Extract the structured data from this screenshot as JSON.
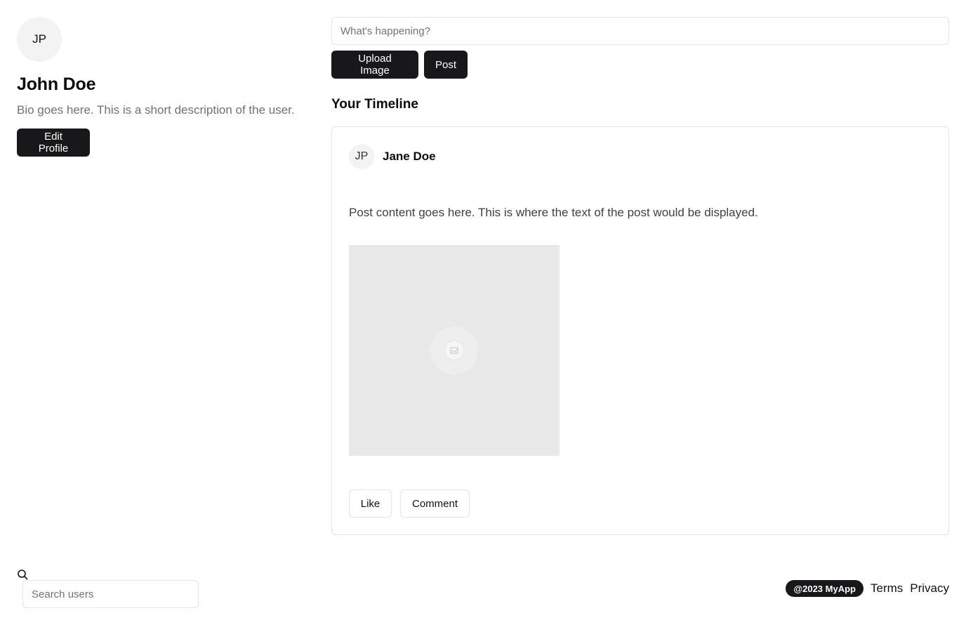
{
  "profile": {
    "avatar_initials": "JP",
    "name": "John Doe",
    "bio": "Bio goes here. This is a short description of the user.",
    "edit_button_label": "Edit Profile"
  },
  "composer": {
    "placeholder": "What's happening?",
    "value": "",
    "upload_button_label": "Upload Image",
    "post_button_label": "Post"
  },
  "timeline": {
    "title": "Your Timeline",
    "posts": [
      {
        "author_initials": "JP",
        "author_name": "Jane Doe",
        "content": "Post content goes here. This is where the text of the post would be displayed.",
        "image_icon": "image-placeholder-icon",
        "like_label": "Like",
        "comment_label": "Comment"
      }
    ]
  },
  "search": {
    "icon": "search-icon",
    "placeholder": "Search users",
    "value": ""
  },
  "footer": {
    "copyright": "@2023 MyApp",
    "links": [
      "Terms",
      "Privacy"
    ]
  },
  "colors": {
    "primary_button": "#18181b",
    "border": "#e4e4e7",
    "muted_text": "#6b7280",
    "avatar_bg": "#f3f3f3",
    "image_placeholder_bg": "#e8e8e8"
  }
}
